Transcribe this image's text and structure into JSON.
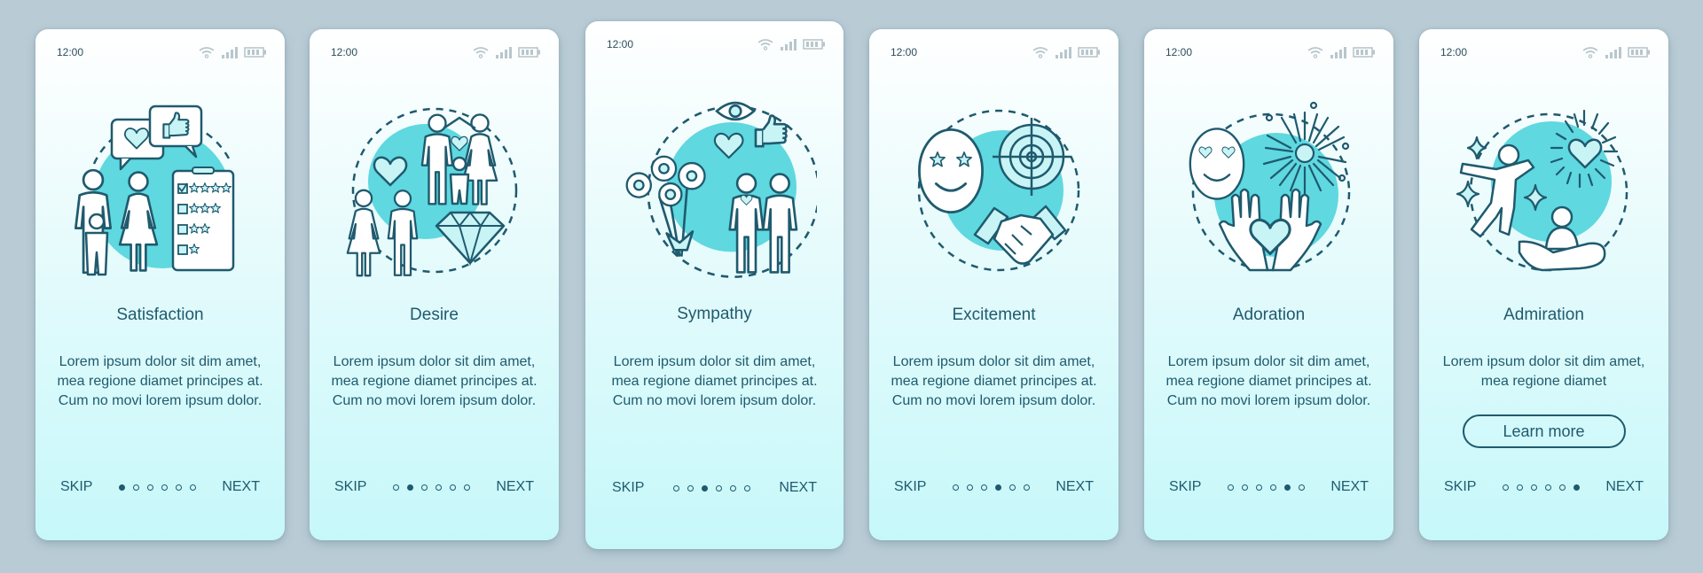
{
  "colors": {
    "background": "#b9ccd6",
    "ink": "#1f5a6e",
    "accent_circle": "#5fd8e0",
    "icon_fill": "#c8f4f6"
  },
  "status_bar": {
    "time": "12:00",
    "icons": [
      "wifi-icon",
      "signal-icon",
      "battery-icon"
    ]
  },
  "cards": [
    {
      "title": "Satisfaction",
      "illustration": "satisfaction-illustration",
      "description": "Lorem ipsum dolor sit dim amet, mea regione diamet principes at. Cum no movi lorem ipsum dolor.",
      "active_page": 1,
      "skip_label": "SKIP",
      "next_label": "NEXT"
    },
    {
      "title": "Desire",
      "illustration": "desire-illustration",
      "description": "Lorem ipsum dolor sit dim amet, mea regione diamet principes at. Cum no movi lorem ipsum dolor.",
      "active_page": 2,
      "skip_label": "SKIP",
      "next_label": "NEXT"
    },
    {
      "title": "Sympathy",
      "illustration": "sympathy-illustration",
      "description": "Lorem ipsum dolor sit dim amet, mea regione diamet principes at. Cum no movi lorem ipsum dolor.",
      "active_page": 3,
      "skip_label": "SKIP",
      "next_label": "NEXT"
    },
    {
      "title": "Excitement",
      "illustration": "excitement-illustration",
      "description": "Lorem ipsum dolor sit dim amet, mea regione diamet principes at. Cum no movi lorem ipsum dolor.",
      "active_page": 4,
      "skip_label": "SKIP",
      "next_label": "NEXT"
    },
    {
      "title": "Adoration",
      "illustration": "adoration-illustration",
      "description": "Lorem ipsum dolor sit dim amet, mea regione diamet principes at. Cum no movi lorem ipsum dolor.",
      "active_page": 5,
      "skip_label": "SKIP",
      "next_label": "NEXT"
    },
    {
      "title": "Admiration",
      "illustration": "admiration-illustration",
      "description": "Lorem ipsum dolor sit dim amet, mea regione diamet",
      "button_label": "Learn more",
      "active_page": 6,
      "skip_label": "SKIP",
      "next_label": "NEXT"
    }
  ],
  "total_pages": 6
}
